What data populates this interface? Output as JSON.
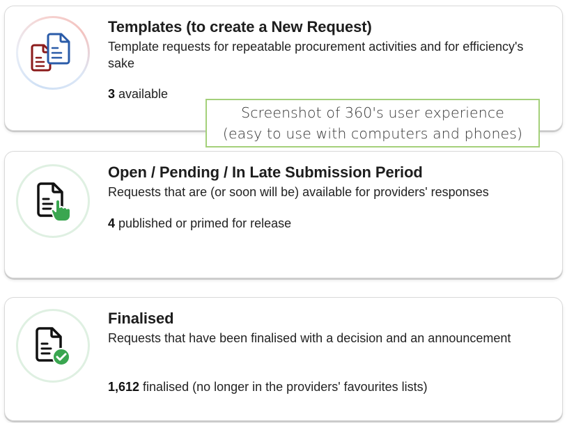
{
  "cards": [
    {
      "id": "templates",
      "title": "Templates (to create a New Request)",
      "description": "Template requests for repeatable procurement activities and for efficiency's sake",
      "count_value": "3",
      "count_suffix": " available",
      "icon": "templates-documents-icon",
      "colors": {
        "doc_front": "#2a5ba8",
        "doc_back": "#8b1a1a"
      }
    },
    {
      "id": "open",
      "title": "Open / Pending / In Late Submission Period",
      "description": "Requests that are (or soon will be) available for providers' responses",
      "count_value": "4",
      "count_suffix": " published or primed for release",
      "icon": "document-pointer-icon",
      "colors": {
        "accent": "#3aa650"
      }
    },
    {
      "id": "finalised",
      "title": "Finalised",
      "description": "Requests that have been finalised with a decision and an announcement",
      "count_value": "1,612",
      "count_suffix": " finalised (no longer in the providers' favourites lists)",
      "icon": "document-checkmark-icon",
      "colors": {
        "accent": "#3aa650"
      }
    }
  ],
  "annotation": {
    "line1": "Screenshot of 360's user experience",
    "line2": "(easy to use with computers and phones)",
    "border_color": "#a4d07a"
  }
}
